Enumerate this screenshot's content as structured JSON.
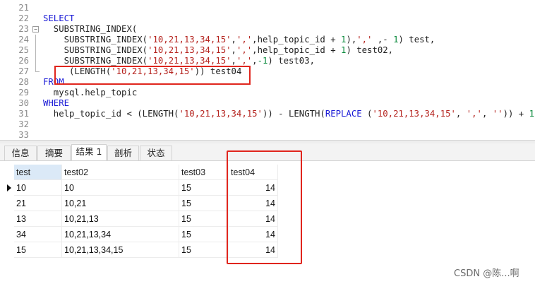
{
  "editor": {
    "lines": [
      {
        "n": "21",
        "parts": []
      },
      {
        "n": "22",
        "parts": [
          {
            "t": "SELECT",
            "c": "kw"
          }
        ]
      },
      {
        "n": "23",
        "parts": [
          {
            "t": "  SUBSTRING_INDEX(",
            "c": ""
          }
        ]
      },
      {
        "n": "24",
        "parts": [
          {
            "t": "    SUBSTRING_INDEX(",
            "c": ""
          },
          {
            "t": "'10,21,13,34,15'",
            "c": "str"
          },
          {
            "t": ",",
            "c": ""
          },
          {
            "t": "','",
            "c": "str"
          },
          {
            "t": ",help_topic_id + ",
            "c": ""
          },
          {
            "t": "1",
            "c": "num"
          },
          {
            "t": "),",
            "c": ""
          },
          {
            "t": "','",
            "c": "str"
          },
          {
            "t": " ,- ",
            "c": ""
          },
          {
            "t": "1",
            "c": "num"
          },
          {
            "t": ") test,",
            "c": ""
          }
        ]
      },
      {
        "n": "25",
        "parts": [
          {
            "t": "    SUBSTRING_INDEX(",
            "c": ""
          },
          {
            "t": "'10,21,13,34,15'",
            "c": "str"
          },
          {
            "t": ",",
            "c": ""
          },
          {
            "t": "','",
            "c": "str"
          },
          {
            "t": ",help_topic_id + ",
            "c": ""
          },
          {
            "t": "1",
            "c": "num"
          },
          {
            "t": ") test02,",
            "c": ""
          }
        ]
      },
      {
        "n": "26",
        "parts": [
          {
            "t": "    SUBSTRING_INDEX(",
            "c": ""
          },
          {
            "t": "'10,21,13,34,15'",
            "c": "str"
          },
          {
            "t": ",",
            "c": ""
          },
          {
            "t": "','",
            "c": "str"
          },
          {
            "t": ",",
            "c": ""
          },
          {
            "t": "-1",
            "c": "num"
          },
          {
            "t": ") test03,",
            "c": ""
          }
        ]
      },
      {
        "n": "27",
        "parts": [
          {
            "t": "     (LENGTH(",
            "c": ""
          },
          {
            "t": "'10,21,13,34,15'",
            "c": "str"
          },
          {
            "t": ")) test04",
            "c": ""
          }
        ]
      },
      {
        "n": "28",
        "parts": [
          {
            "t": "FROM",
            "c": "kw"
          }
        ]
      },
      {
        "n": "29",
        "parts": [
          {
            "t": "  mysql.help_topic",
            "c": ""
          }
        ]
      },
      {
        "n": "30",
        "parts": [
          {
            "t": "WHERE",
            "c": "kw"
          }
        ]
      },
      {
        "n": "31",
        "parts": [
          {
            "t": "  help_topic_id < (LENGTH(",
            "c": ""
          },
          {
            "t": "'10,21,13,34,15'",
            "c": "str"
          },
          {
            "t": ")) - LENGTH(",
            "c": ""
          },
          {
            "t": "REPLACE",
            "c": "kw"
          },
          {
            "t": " (",
            "c": ""
          },
          {
            "t": "'10,21,13,34,15'",
            "c": "str"
          },
          {
            "t": ", ",
            "c": ""
          },
          {
            "t": "','",
            "c": "str"
          },
          {
            "t": ", ",
            "c": ""
          },
          {
            "t": "''",
            "c": "str"
          },
          {
            "t": ")) + ",
            "c": ""
          },
          {
            "t": "1",
            "c": "num"
          },
          {
            "t": ";",
            "c": ""
          }
        ]
      },
      {
        "n": "32",
        "parts": []
      },
      {
        "n": "33",
        "parts": []
      }
    ]
  },
  "tabs": [
    {
      "label": "信息",
      "active": false
    },
    {
      "label": "摘要",
      "active": false
    },
    {
      "label": "结果 1",
      "active": true
    },
    {
      "label": "剖析",
      "active": false
    },
    {
      "label": "状态",
      "active": false
    }
  ],
  "grid": {
    "columns": [
      "test",
      "test02",
      "test03",
      "test04"
    ],
    "rows": [
      [
        "10",
        "10",
        "15",
        "14"
      ],
      [
        "21",
        "10,21",
        "15",
        "14"
      ],
      [
        "13",
        "10,21,13",
        "15",
        "14"
      ],
      [
        "34",
        "10,21,13,34",
        "15",
        "14"
      ],
      [
        "15",
        "10,21,13,34,15",
        "15",
        "14"
      ]
    ]
  },
  "watermark": "CSDN @陈...啊",
  "colors": {
    "keyword": "#1a1ad6",
    "string": "#b5241f",
    "number": "#0a8a3c",
    "highlight": "#e0251d",
    "header_selected": "#dbe9f7"
  }
}
